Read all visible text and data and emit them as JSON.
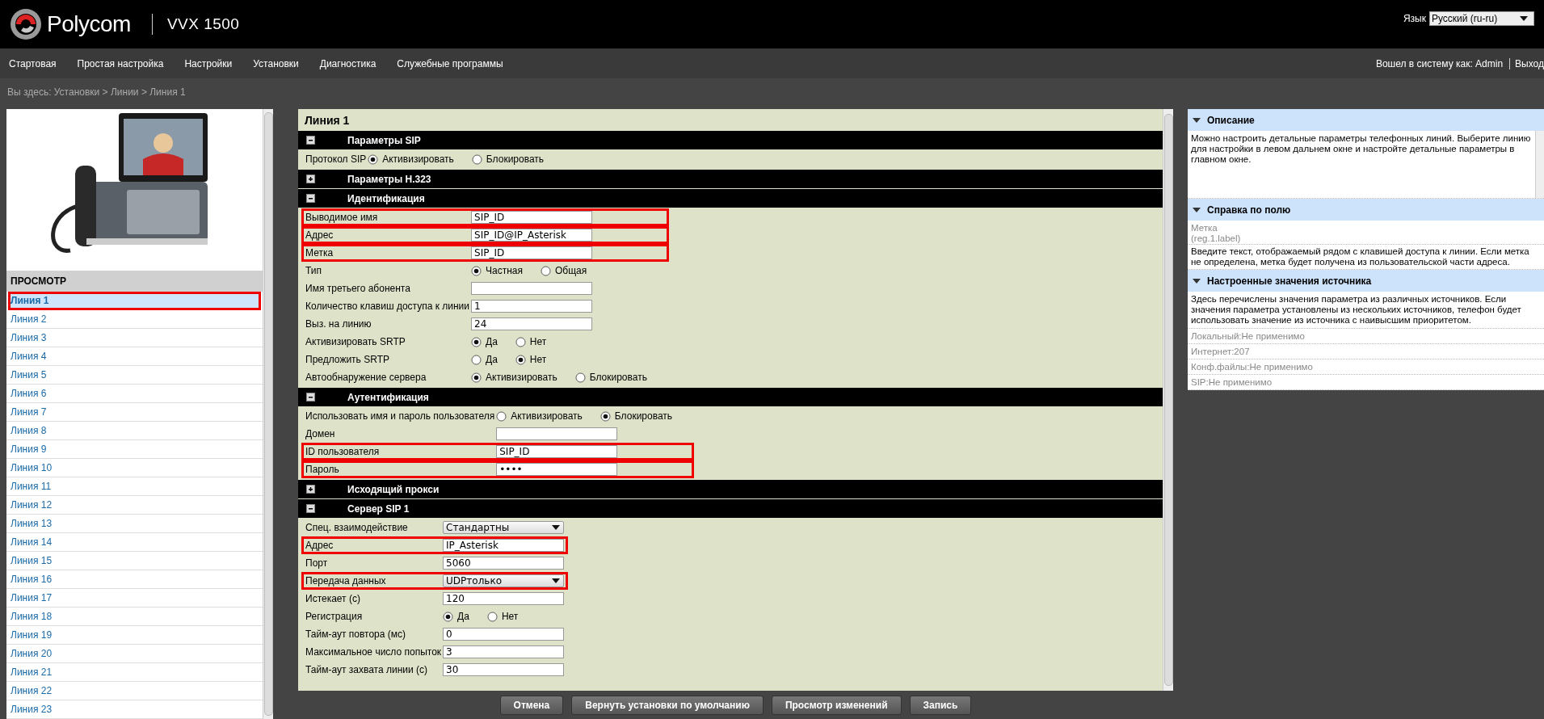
{
  "header": {
    "logo": "Polycom",
    "model": "VVX 1500",
    "language_label": "Язык",
    "language": "Русский (ru-ru)"
  },
  "nav": {
    "items": [
      "Стартовая",
      "Простая настройка",
      "Настройки",
      "Установки",
      "Диагностика",
      "Служебные программы"
    ],
    "login": "Вошел в систему как: Admin",
    "logout": "Выход"
  },
  "breadcrumb": "Вы здесь: Установки > Линии > Линия 1",
  "sidebar": {
    "title": "ПРОСМОТР",
    "items": [
      {
        "label": "Линия 1",
        "selected": true,
        "highlighted": true
      },
      {
        "label": "Линия 2",
        "selected": false,
        "highlighted": false
      },
      {
        "label": "Линия 3",
        "selected": false,
        "highlighted": false
      },
      {
        "label": "Линия 4",
        "selected": false,
        "highlighted": false
      },
      {
        "label": "Линия 5",
        "selected": false,
        "highlighted": false
      },
      {
        "label": "Линия 6",
        "selected": false,
        "highlighted": false
      },
      {
        "label": "Линия 7",
        "selected": false,
        "highlighted": false
      },
      {
        "label": "Линия 8",
        "selected": false,
        "highlighted": false
      },
      {
        "label": "Линия 9",
        "selected": false,
        "highlighted": false
      },
      {
        "label": "Линия 10",
        "selected": false,
        "highlighted": false
      },
      {
        "label": "Линия 11",
        "selected": false,
        "highlighted": false
      },
      {
        "label": "Линия 12",
        "selected": false,
        "highlighted": false
      },
      {
        "label": "Линия 13",
        "selected": false,
        "highlighted": false
      },
      {
        "label": "Линия 14",
        "selected": false,
        "highlighted": false
      },
      {
        "label": "Линия 15",
        "selected": false,
        "highlighted": false
      },
      {
        "label": "Линия 16",
        "selected": false,
        "highlighted": false
      },
      {
        "label": "Линия 17",
        "selected": false,
        "highlighted": false
      },
      {
        "label": "Линия 18",
        "selected": false,
        "highlighted": false
      },
      {
        "label": "Линия 19",
        "selected": false,
        "highlighted": false
      },
      {
        "label": "Линия 20",
        "selected": false,
        "highlighted": false
      },
      {
        "label": "Линия 21",
        "selected": false,
        "highlighted": false
      },
      {
        "label": "Линия 22",
        "selected": false,
        "highlighted": false
      },
      {
        "label": "Линия 23",
        "selected": false,
        "highlighted": false
      }
    ]
  },
  "main": {
    "title": "Линия 1",
    "sections": [
      {
        "title": "Параметры SIP",
        "expanded": true,
        "rows": [
          {
            "kind": "radio",
            "label": "Протокол SIP",
            "highlighted": false,
            "options": [
              {
                "label": "Активизировать",
                "selected": true
              },
              {
                "label": "Блокировать",
                "selected": false
              }
            ]
          }
        ]
      },
      {
        "title": "Параметры H.323",
        "expanded": false
      },
      {
        "title": "Идентификация",
        "expanded": true,
        "rows": [
          {
            "kind": "text",
            "label": "Выводимое имя",
            "value": "SIP_ID",
            "highlighted": true
          },
          {
            "kind": "text",
            "label": "Адрес",
            "value": "SIP_ID@IP_Asterisk",
            "highlighted": true
          },
          {
            "kind": "text",
            "label": "Метка",
            "value": "SIP_ID",
            "highlighted": true
          },
          {
            "kind": "radio",
            "label": "Тип",
            "highlighted": false,
            "options": [
              {
                "label": "Частная",
                "selected": true
              },
              {
                "label": "Общая",
                "selected": false
              }
            ]
          },
          {
            "kind": "text",
            "label": "Имя третьего абонента",
            "highlighted": false
          },
          {
            "kind": "text",
            "label": "Количество клавиш доступа к линии",
            "value": "1",
            "highlighted": false
          },
          {
            "kind": "text",
            "label": "Выз. на линию",
            "value": "24",
            "highlighted": false
          },
          {
            "kind": "radio",
            "label": "Активизировать SRTP",
            "highlighted": false,
            "options": [
              {
                "label": "Да",
                "selected": true
              },
              {
                "label": "Нет",
                "selected": false
              }
            ]
          },
          {
            "kind": "radio",
            "label": "Предложить SRTP",
            "highlighted": false,
            "options": [
              {
                "label": "Да",
                "selected": false
              },
              {
                "label": "Нет",
                "selected": true
              }
            ]
          },
          {
            "kind": "radio",
            "label": "Автообнаружение сервера",
            "highlighted": false,
            "options": [
              {
                "label": "Активизировать",
                "selected": true
              },
              {
                "label": "Блокировать",
                "selected": false
              }
            ]
          }
        ]
      },
      {
        "title": "Аутентификация",
        "expanded": true,
        "rows": [
          {
            "kind": "radio",
            "label": "Использовать имя и пароль пользователя",
            "highlighted": false,
            "options": [
              {
                "label": "Активизировать",
                "selected": false
              },
              {
                "label": "Блокировать",
                "selected": true
              }
            ]
          },
          {
            "kind": "text",
            "label": "Домен",
            "highlighted": false
          },
          {
            "kind": "text",
            "label": "ID пользователя",
            "value": "SIP_ID",
            "highlighted": true
          },
          {
            "kind": "password",
            "label": "Пароль",
            "value": "••••",
            "highlighted": true
          }
        ]
      },
      {
        "title": "Исходящий прокси",
        "expanded": false
      },
      {
        "title": "Сервер SIP 1",
        "expanded": true,
        "rows": [
          {
            "kind": "select",
            "label": "Спец. взаимодействие",
            "value": "Стандартны",
            "highlighted": false
          },
          {
            "kind": "text",
            "label": "Адрес",
            "value": "IP_Asterisk",
            "highlighted": true
          },
          {
            "kind": "text",
            "label": "Порт",
            "value": "5060",
            "highlighted": false
          },
          {
            "kind": "select",
            "label": "Передача данных",
            "value": "UDPтолько",
            "highlighted": true
          },
          {
            "kind": "text",
            "label": "Истекает (с)",
            "value": "120",
            "highlighted": false
          },
          {
            "kind": "radio",
            "label": "Регистрация",
            "highlighted": false,
            "options": [
              {
                "label": "Да",
                "selected": true
              },
              {
                "label": "Нет",
                "selected": false
              }
            ]
          },
          {
            "kind": "text",
            "label": "Тайм-аут повтора (мс)",
            "value": "0",
            "highlighted": false
          },
          {
            "kind": "text",
            "label": "Максимальное число попыток",
            "value": "3",
            "highlighted": false
          },
          {
            "kind": "text",
            "label": "Тайм-аут захвата линии (с)",
            "value": "30",
            "highlighted": false
          }
        ]
      }
    ],
    "buttons": [
      "Отмена",
      "Вернуть установки по умолчанию",
      "Просмотр изменений",
      "Запись"
    ]
  },
  "info": {
    "description": {
      "title": "Описание",
      "text": "Можно настроить детальные параметры телефонных линий. Выберите линию для настройки в левом дальнем окне и настройте  детальные параметры в главном окне."
    },
    "field_help": {
      "title": "Справка по полю",
      "field": "Метка",
      "param": "(reg.1.label)",
      "text": "Введите текст, отображаемый рядом с клавишей доступа к линии. Если метка не определена, метка будет получена из пользовательской части адреса."
    },
    "sources": {
      "title": "Настроенные значения источника",
      "text": "Здесь перечислены значения параметра из различных источников. Если значения параметра установлены из нескольких источников, телефон будет использовать значение из источника с наивысшим приоритетом.",
      "items": [
        "Локальный:Не применимо",
        "Интернет:207",
        "Конф.файлы:Не применимо",
        "SIP:Не применимо"
      ]
    }
  }
}
